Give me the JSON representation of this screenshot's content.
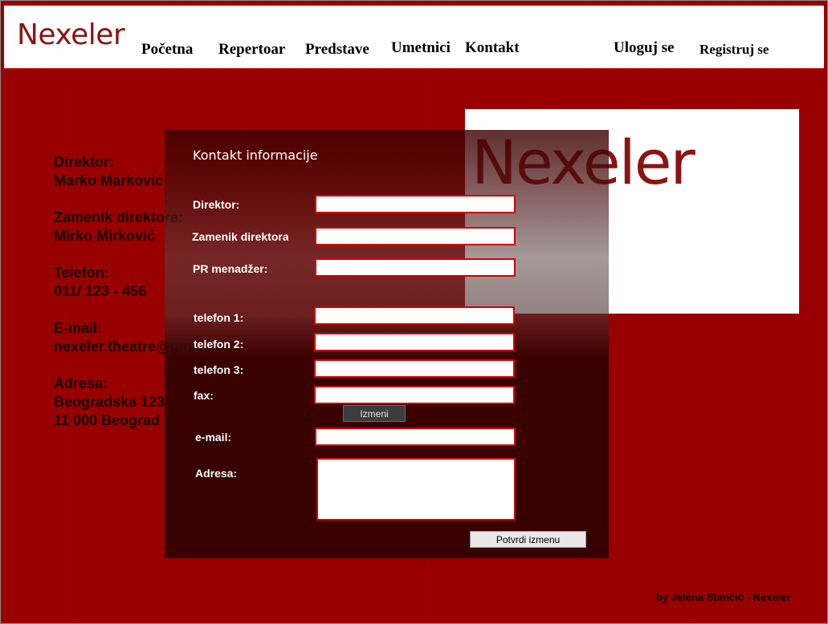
{
  "header": {
    "logo": "Nexeler",
    "nav": [
      "Početna",
      "Repertoar",
      "Predstave",
      "Umetnici",
      "Kontakt"
    ],
    "login": "Uloguj se",
    "register": "Registruj se"
  },
  "info": {
    "director_label": "Direktor:",
    "director_value": "Marko Marković",
    "deputy_label": "Zamenik direktora:",
    "deputy_value": "Mirko Mirković",
    "phone_label": "Telefon:",
    "phone_value": "011/ 123 - 456",
    "email_label": "E-mail:",
    "email_value": "nexeler.theatre@gmail.com",
    "address_label": "Adresa:",
    "address_line1": "Beogradska 123",
    "address_line2": "11 000 Beograd"
  },
  "logo_box": {
    "text": "Nexeler"
  },
  "form": {
    "title": "Kontakt informacije",
    "labels": {
      "director": "Direktor:",
      "deputy": "Zamenik direktora:",
      "pr": "PR menadžer:",
      "phone1": "telefon 1:",
      "phone2": "telefon 2:",
      "phone3": "telefon 3:",
      "fax": "fax:",
      "email": "e-mail:",
      "address": "Adresa:"
    },
    "values": {
      "director": "",
      "deputy": "",
      "pr": "",
      "phone1": "",
      "phone2": "",
      "phone3": "",
      "fax": "",
      "email": "",
      "address": ""
    },
    "izmeni_button": "Izmeni",
    "submit_button": "Potvrdi izmenu"
  },
  "footer": {
    "text": "by Jelena Stančić - Nexeler"
  },
  "colors": {
    "background": "#9a0000",
    "accent": "#d40000",
    "logo": "#8b1414",
    "panel": "#340000"
  }
}
